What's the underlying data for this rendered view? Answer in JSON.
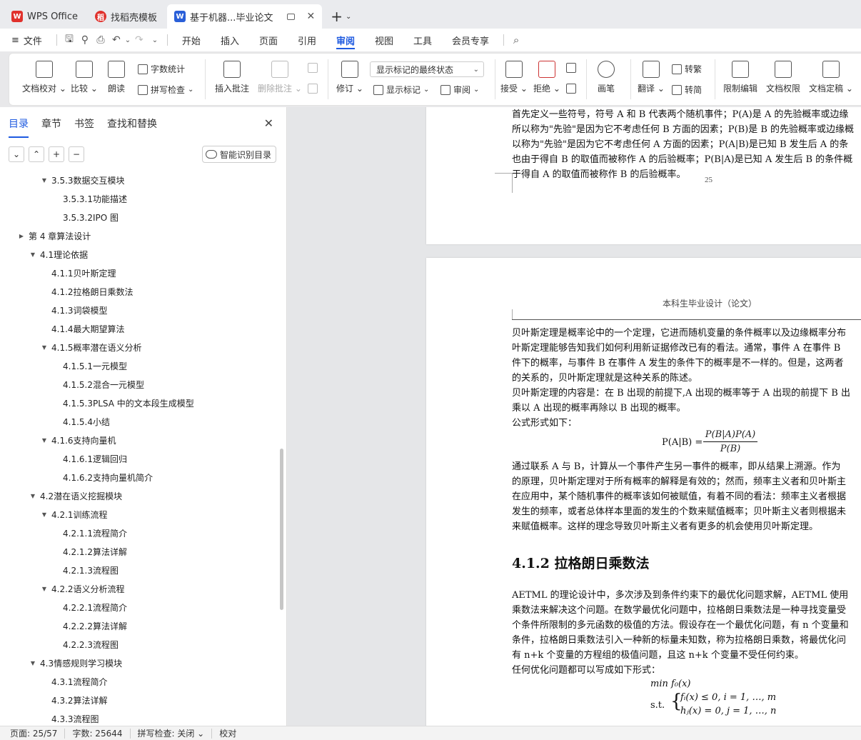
{
  "tabs": [
    {
      "label": "WPS Office",
      "icon": "wps-logo-icon",
      "color": "#e0312c"
    },
    {
      "label": "找稻壳模板",
      "icon": "docer-logo-icon",
      "color": "#e0312c"
    },
    {
      "label": "基于机器...毕业论文",
      "icon": "word-doc-icon",
      "color": "#2a5fd8"
    }
  ],
  "menu": {
    "file": "文件",
    "items": [
      "开始",
      "插入",
      "页面",
      "引用",
      "审阅",
      "视图",
      "工具",
      "会员专享"
    ],
    "active": "审阅"
  },
  "ribbon": {
    "doc_check": "文档校对",
    "compare": "比较",
    "read_aloud": "朗读",
    "word_count": "字数统计",
    "spell_check": "拼写检查",
    "insert_comment": "插入批注",
    "delete_comment": "删除批注",
    "revise": "修订",
    "markup_state": "显示标记的最终状态",
    "show_markup": "显示标记",
    "review": "审阅",
    "accept": "接受",
    "reject": "拒绝",
    "pen": "画笔",
    "translate": "翻译",
    "to_traditional": "转繁",
    "to_simplified": "转简",
    "restrict_edit": "限制编辑",
    "doc_permission": "文档权限",
    "doc_finalize": "文档定稿"
  },
  "sidebar": {
    "tabs": [
      "目录",
      "章节",
      "书签",
      "查找和替换"
    ],
    "active_tab": "目录",
    "smart_toc": "智能识别目录",
    "toc": [
      {
        "text": "3.5.3数据交互模块",
        "level": 2,
        "arrow": "down"
      },
      {
        "text": "3.5.3.1功能描述",
        "level": 3,
        "arrow": ""
      },
      {
        "text": "3.5.3.2IPO 图",
        "level": 3,
        "arrow": ""
      },
      {
        "text": "第 4 章算法设计",
        "level": 0,
        "arrow": "right"
      },
      {
        "text": "4.1理论依据",
        "level": 1,
        "arrow": "down"
      },
      {
        "text": "4.1.1贝叶斯定理",
        "level": 2,
        "arrow": ""
      },
      {
        "text": "4.1.2拉格朗日乘数法",
        "level": 2,
        "arrow": ""
      },
      {
        "text": "4.1.3词袋模型",
        "level": 2,
        "arrow": ""
      },
      {
        "text": "4.1.4最大期望算法",
        "level": 2,
        "arrow": ""
      },
      {
        "text": "4.1.5概率潜在语义分析",
        "level": 2,
        "arrow": "down"
      },
      {
        "text": "4.1.5.1一元模型",
        "level": 3,
        "arrow": ""
      },
      {
        "text": "4.1.5.2混合一元模型",
        "level": 3,
        "arrow": ""
      },
      {
        "text": "4.1.5.3PLSA 中的文本段生成模型",
        "level": 3,
        "arrow": ""
      },
      {
        "text": "4.1.5.4小结",
        "level": 3,
        "arrow": ""
      },
      {
        "text": "4.1.6支持向量机",
        "level": 2,
        "arrow": "down"
      },
      {
        "text": "4.1.6.1逻辑回归",
        "level": 3,
        "arrow": ""
      },
      {
        "text": "4.1.6.2支持向量机简介",
        "level": 3,
        "arrow": ""
      },
      {
        "text": "4.2潜在语义挖掘模块",
        "level": 1,
        "arrow": "down"
      },
      {
        "text": "4.2.1训练流程",
        "level": 2,
        "arrow": "down"
      },
      {
        "text": "4.2.1.1流程简介",
        "level": 3,
        "arrow": ""
      },
      {
        "text": "4.2.1.2算法详解",
        "level": 3,
        "arrow": ""
      },
      {
        "text": "4.2.1.3流程图",
        "level": 3,
        "arrow": ""
      },
      {
        "text": "4.2.2语义分析流程",
        "level": 2,
        "arrow": "down"
      },
      {
        "text": "4.2.2.1流程简介",
        "level": 3,
        "arrow": ""
      },
      {
        "text": "4.2.2.2算法详解",
        "level": 3,
        "arrow": ""
      },
      {
        "text": "4.2.2.3流程图",
        "level": 3,
        "arrow": ""
      },
      {
        "text": "4.3情感规则学习模块",
        "level": 1,
        "arrow": "down"
      },
      {
        "text": "4.3.1流程简介",
        "level": 2,
        "arrow": ""
      },
      {
        "text": "4.3.2算法详解",
        "level": 2,
        "arrow": ""
      },
      {
        "text": "4.3.3流程图",
        "level": 2,
        "arrow": ""
      }
    ]
  },
  "doc": {
    "page1_lines": [
      "首先定义一些符号，符号 A 和 B 代表两个随机事件；P(A)是 A 的先验概率或边缘",
      "所以称为\"先验\"是因为它不考虑任何 B 方面的因素；P(B)是 B 的先验概率或边缘概",
      "以称为\"先验\"是因为它不考虑任何 A 方面的因素；P(A|B)是已知 B 发生后 A 的条",
      "也由于得自 B 的取值而被称作 A 的后验概率；P(B|A)是已知 A 发生后 B 的条件概",
      "于得自 A 的取值而被称作 B 的后验概率。"
    ],
    "page1_number": "25",
    "header": "本科生毕业设计（论文）",
    "para1": [
      "贝叶斯定理是概率论中的一个定理，它进而随机变量的条件概率以及边缘概率分布",
      "叶斯定理能够告知我们如何利用新证据修改已有的看法。通常，事件 A 在事件 B",
      "件下的概率，与事件 B 在事件 A 发生的条件下的概率是不一样的。但是，这两者",
      "的关系的，贝叶斯定理就是这种关系的陈述。",
      "贝叶斯定理的内容是：在 B 出现的前提下,A 出现的概率等于 A 出现的前提下 B 出",
      "乘以 A 出现的概率再除以 B 出现的概率。",
      "公式形式如下："
    ],
    "formula_lhs": "P(A|B) =",
    "formula_num": "P(B|A)P(A)",
    "formula_den": "P(B)",
    "para2": [
      "通过联系 A 与 B，计算从一个事件产生另一事件的概率，即从结果上溯源。作为",
      "的原理，贝叶斯定理对于所有概率的解释是有效的；然而，频率主义者和贝叶斯主",
      "在应用中，某个随机事件的概率该如何被赋值，有着不同的看法：频率主义者根据",
      "发生的频率，或者总体样本里面的发生的个数来赋值概率；贝叶斯主义者则根据未",
      "来赋值概率。这样的理念导致贝叶斯主义者有更多的机会使用贝叶斯定理。"
    ],
    "heading": "4.1.2 拉格朗日乘数法",
    "para3": [
      "AETML 的理论设计中，多次涉及到条件约束下的最优化问题求解，AETML 使用",
      "乘数法来解决这个问题。在数学最优化问题中，拉格朗日乘数法是一种寻找变量受",
      "个条件所限制的多元函数的极值的方法。假设存在一个最优化问题，有 n 个变量和",
      "条件，拉格朗日乘数法引入一种新的标量未知数，称为拉格朗日乘数，将最优化问",
      "有 n+k 个变量的方程组的极值问题，且这 n+k 个变量不受任何约束。",
      "任何优化问题都可以写成如下形式："
    ],
    "opt_min": "min  f₀(x)",
    "opt_st": "s.t.",
    "opt_c1": "fᵢ(x) ≤ 0, i = 1, …, m",
    "opt_c2": "hⱼ(x) = 0, j = 1, …, n"
  },
  "status": {
    "page": "页面: 25/57",
    "words": "字数: 25644",
    "spell": "拼写检查: 关闭",
    "proof": "校对"
  }
}
